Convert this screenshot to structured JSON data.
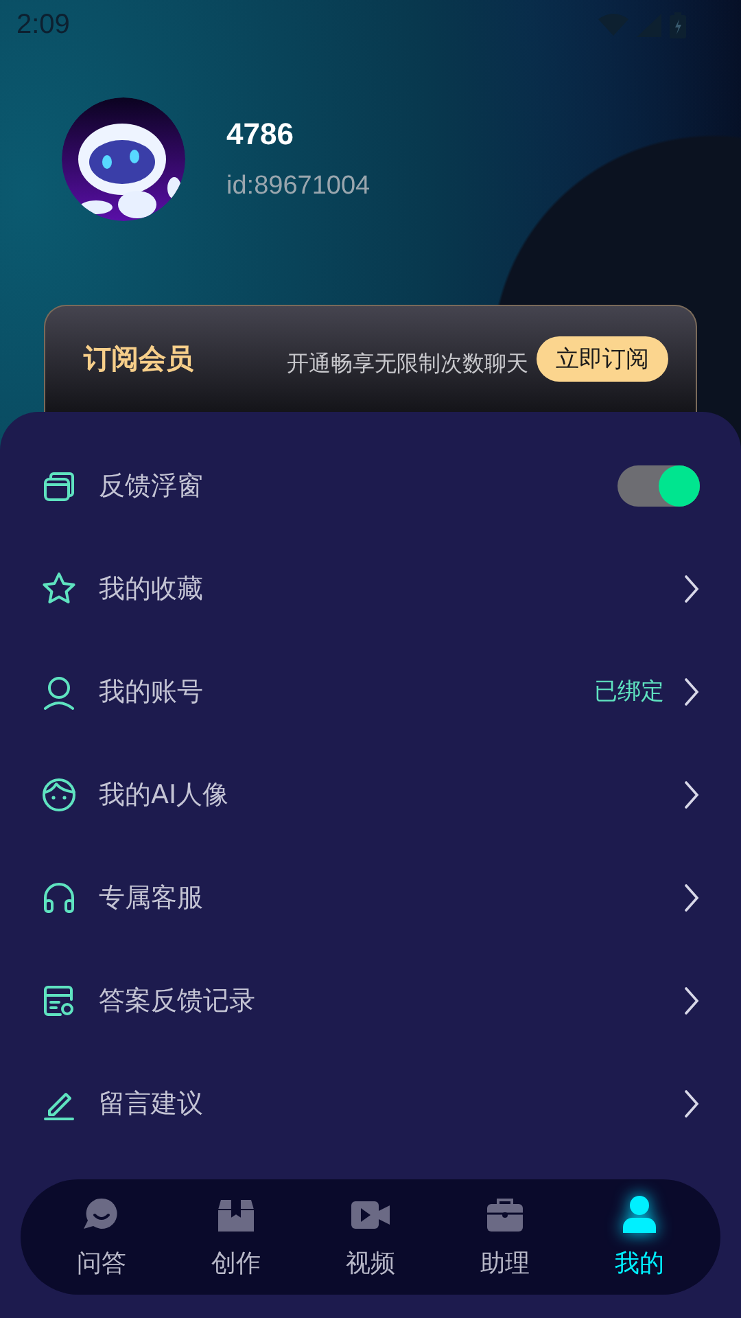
{
  "status_bar": {
    "time": "2:09"
  },
  "profile": {
    "name": "4786",
    "id": "id:89671004"
  },
  "membership": {
    "title": "订阅会员",
    "description": "开通畅享无限制次数聊天",
    "button": "立即订阅"
  },
  "menu": [
    {
      "kind": "toggle",
      "label": "反馈浮窗",
      "on": true
    },
    {
      "kind": "link",
      "label": "我的收藏"
    },
    {
      "kind": "link",
      "label": "我的账号",
      "value": "已绑定"
    },
    {
      "kind": "link",
      "label": "我的AI人像"
    },
    {
      "kind": "link",
      "label": "专属客服"
    },
    {
      "kind": "link",
      "label": "答案反馈记录"
    },
    {
      "kind": "link",
      "label": "留言建议"
    }
  ],
  "tabs": [
    {
      "label": "问答",
      "selected": false
    },
    {
      "label": "创作",
      "selected": false
    },
    {
      "label": "视频",
      "selected": false
    },
    {
      "label": "助理",
      "selected": false
    },
    {
      "label": "我的",
      "selected": true
    }
  ]
}
